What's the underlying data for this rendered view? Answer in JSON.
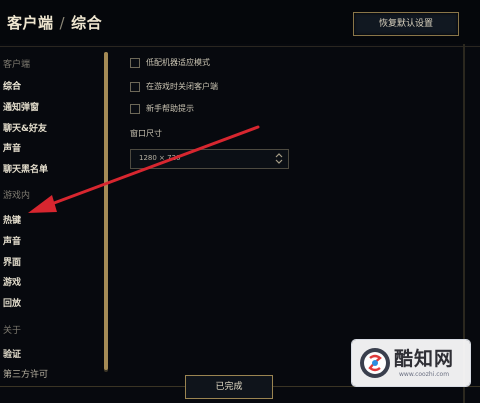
{
  "header": {
    "title_section": "客户端",
    "title_separator": "/",
    "title_page": "综合",
    "restore_defaults_label": "恢复默认设置"
  },
  "sidebar": {
    "client_group": "客户端",
    "client_items": [
      "综合",
      "通知弹窗",
      "聊天&好友",
      "声音",
      "聊天黑名单"
    ],
    "ingame_group": "游戏内",
    "ingame_items": [
      "热键",
      "声音",
      "界面",
      "游戏",
      "回放"
    ],
    "about_group": "关于",
    "about_items": [
      "验证",
      "第三方许可"
    ]
  },
  "general": {
    "options": [
      {
        "label": "低配机器适应模式",
        "checked": false
      },
      {
        "label": "在游戏时关闭客户端",
        "checked": false
      },
      {
        "label": "新手帮助提示",
        "checked": false
      }
    ],
    "window_size_label": "窗口尺寸",
    "window_size_value": "1280 × 720"
  },
  "footer": {
    "done_label": "已完成"
  },
  "watermark": {
    "name": "酷知网",
    "url": "www.coozhi.com"
  },
  "colors": {
    "background": "#07090e",
    "gold_border": "#9a8451",
    "annotation_arrow": "#e0303a"
  },
  "icons": {
    "select_arrow": "chevron-up-down-icon",
    "annotation": "red-arrow-annotation",
    "watermark_logo": "coozhi-logo-icon"
  }
}
